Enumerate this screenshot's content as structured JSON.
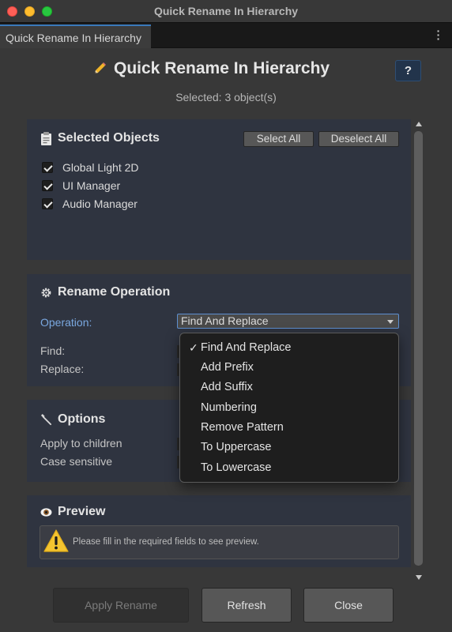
{
  "window": {
    "title": "Quick Rename In Hierarchy"
  },
  "tab": {
    "label": "Quick Rename In Hierarchy"
  },
  "header": {
    "title": "Quick Rename In Hierarchy",
    "help_label": "?",
    "selected_count": "Selected: 3 object(s)"
  },
  "selected_objects": {
    "title": "Selected Objects",
    "select_all_label": "Select All",
    "deselect_all_label": "Deselect All",
    "items": [
      {
        "label": "Global Light 2D",
        "checked": true
      },
      {
        "label": "UI Manager",
        "checked": true
      },
      {
        "label": "Audio Manager",
        "checked": true
      }
    ]
  },
  "rename_operation": {
    "title": "Rename Operation",
    "operation_label": "Operation:",
    "operation_value": "Find And Replace",
    "find_label": "Find:",
    "replace_label": "Replace:"
  },
  "options": {
    "title": "Options",
    "apply_children_label": "Apply to children",
    "case_sensitive_label": "Case sensitive"
  },
  "preview": {
    "title": "Preview",
    "warning": "Please fill in the required fields to see preview."
  },
  "footer": {
    "apply_label": "Apply Rename",
    "refresh_label": "Refresh",
    "close_label": "Close"
  },
  "dropdown": {
    "selected_mark": "✓",
    "options": [
      "Find And Replace",
      "Add Prefix",
      "Add Suffix",
      "Numbering",
      "Remove Pattern",
      "To Uppercase",
      "To Lowercase"
    ]
  },
  "colors": {
    "accent": "#5d8fd0",
    "section_bg": "#2f3440",
    "panel_bg": "#383838",
    "warning_yellow": "#f4c430"
  }
}
